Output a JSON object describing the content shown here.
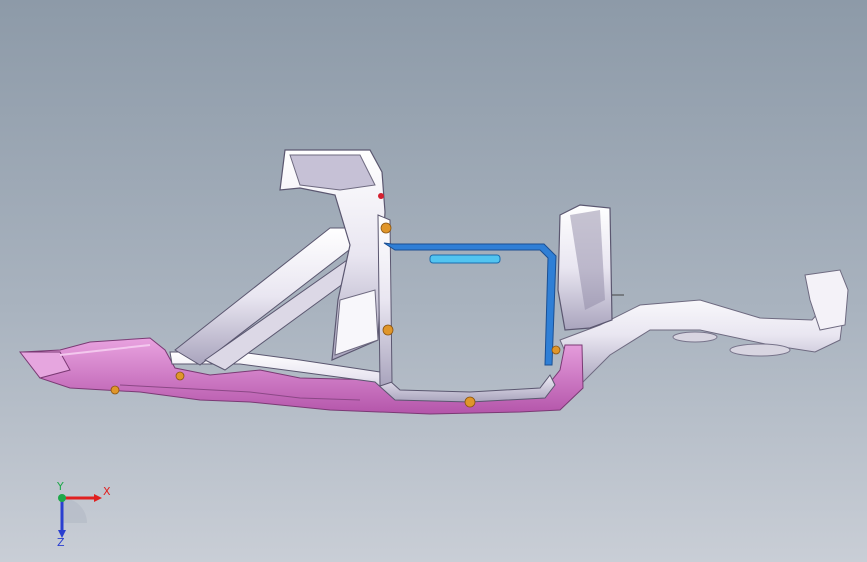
{
  "viewport": {
    "background_top": "#8d9aa8",
    "background_bottom": "#c9ced6"
  },
  "model": {
    "part_colors": {
      "tube_frame": "#eeeaf4",
      "skid_plate": "#d77fcd",
      "crossmember_channel": "#2f7fd6",
      "channel_highlight": "#52c4f0",
      "weld_points": "#e0962a"
    }
  },
  "triad": {
    "x_label": "X",
    "y_label": "Y",
    "z_label": "Z",
    "x_color": "#e02020",
    "y_color": "#1ea84a",
    "z_color": "#2a3fd0"
  }
}
